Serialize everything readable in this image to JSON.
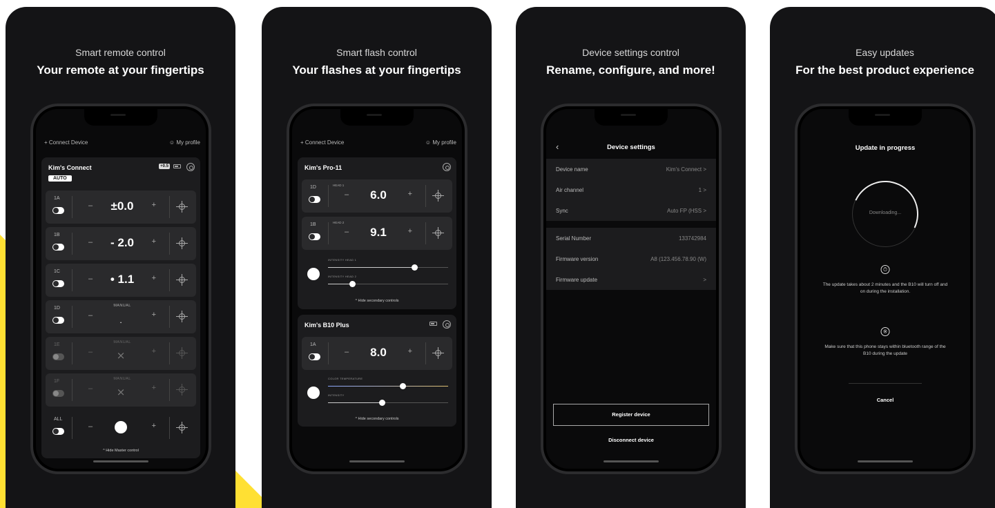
{
  "colors": {
    "accent_yellow": "#ffe033",
    "panel_bg": "#141416",
    "card_bg": "#1c1c1e",
    "row_bg": "#2a2a2c"
  },
  "panel1": {
    "caption": "Smart remote control",
    "headline": "Your remote at your fingertips",
    "connect": "+ Connect Device",
    "profile": "My profile",
    "device_title": "Kim's Connect",
    "auto_badge": "AUTO",
    "hss_badge": "+0.5",
    "groups": [
      {
        "id": "1A",
        "value": "±0.0",
        "mode": ""
      },
      {
        "id": "1B",
        "value": "- 2.0",
        "mode": ""
      },
      {
        "id": "1C",
        "value": "• 1.1",
        "mode": ""
      },
      {
        "id": "1D",
        "value": ".",
        "mode": "MANUAL"
      },
      {
        "id": "1E",
        "value": "",
        "mode": "MANUAL"
      },
      {
        "id": "1F",
        "value": "",
        "mode": "MANUAL"
      },
      {
        "id": "ALL",
        "value": "",
        "mode": ""
      }
    ],
    "minus": "–",
    "plus": "+",
    "hide_master": "^ Hide Master control"
  },
  "panel2": {
    "caption": "Smart flash control",
    "headline": "Your flashes at your fingertips",
    "connect": "+ Connect Device",
    "profile": "My profile",
    "device1": {
      "title": "Kim's Pro-11",
      "heads": [
        {
          "id": "1D",
          "label": "HEAD 1",
          "value": "6.0"
        },
        {
          "id": "1B",
          "label": "HEAD 2",
          "value": "9.1"
        }
      ],
      "slider1_label": "INTENSITY HEAD 1",
      "slider1_level": 0.72,
      "slider2_label": "INTENSITY HEAD 2",
      "slider2_level": 0.2,
      "hide_text": "^ Hide secondary controls"
    },
    "device2": {
      "title": "Kim's B10 Plus",
      "row": {
        "id": "1A",
        "value": "8.0"
      },
      "slider1_label": "COLOR TEMPERATURE",
      "slider1_level": 0.62,
      "slider2_label": "INTENSITY",
      "slider2_level": 0.45,
      "hide_text": "^ Hide secondary controls"
    }
  },
  "panel3": {
    "caption": "Device settings control",
    "headline": "Rename, configure, and more!",
    "title": "Device settings",
    "group1": [
      {
        "k": "Device name",
        "v": "Kim's Connect  >"
      },
      {
        "k": "Air channel",
        "v": "1  >"
      },
      {
        "k": "Sync",
        "v": "Auto FP (HSS  >"
      }
    ],
    "group2": [
      {
        "k": "Serial Number",
        "v": "133742984"
      },
      {
        "k": "Firmware version",
        "v": "A8 (123.456.78.90 (W)"
      },
      {
        "k": "Firmware update",
        "v": ">"
      }
    ],
    "register": "Register device",
    "disconnect": "Disconnect device"
  },
  "panel4": {
    "caption": "Easy updates",
    "headline": "For the best product experience",
    "title": "Update in progress",
    "status": "Downloading...",
    "para1": "The update takes about 2 minutes and the B10 will turn off and on during the installation.",
    "para2": "Make sure that this phone stays within bluetooth range of the B10 during the update",
    "cancel": "Cancel"
  }
}
